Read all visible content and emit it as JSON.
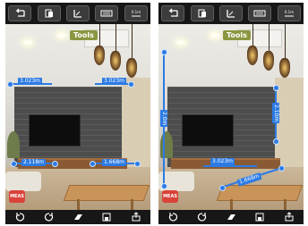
{
  "screens": [
    {
      "tools_label": "Tools",
      "measurements": [
        "3.023m",
        "3.023m",
        "2.118m",
        "1.668m"
      ],
      "top_icons": [
        "undo-arrow-icon",
        "copy-icon",
        "ruler-icon",
        "keyboard-icon",
        "scale-icon"
      ],
      "bottom_icons": [
        "rotate-left-icon",
        "rotate-right-icon",
        "eraser-icon",
        "save-icon",
        "share-icon"
      ]
    },
    {
      "tools_label": "Tools",
      "measurements": [
        "2.0m",
        "2.10m",
        "3.023m",
        "1.668m"
      ],
      "top_icons": [
        "undo-arrow-icon",
        "copy-icon",
        "ruler-icon",
        "keyboard-icon",
        "scale-icon"
      ],
      "bottom_icons": [
        "rotate-left-icon",
        "rotate-right-icon",
        "eraser-icon",
        "save-icon",
        "share-icon"
      ]
    }
  ],
  "top_toolbar": {
    "scale_label": "0.1m"
  },
  "logo_text": "MEAS",
  "colors": {
    "accent": "#2c7be5",
    "tools_badge": "#8c9640",
    "toolbar": "#171717"
  }
}
